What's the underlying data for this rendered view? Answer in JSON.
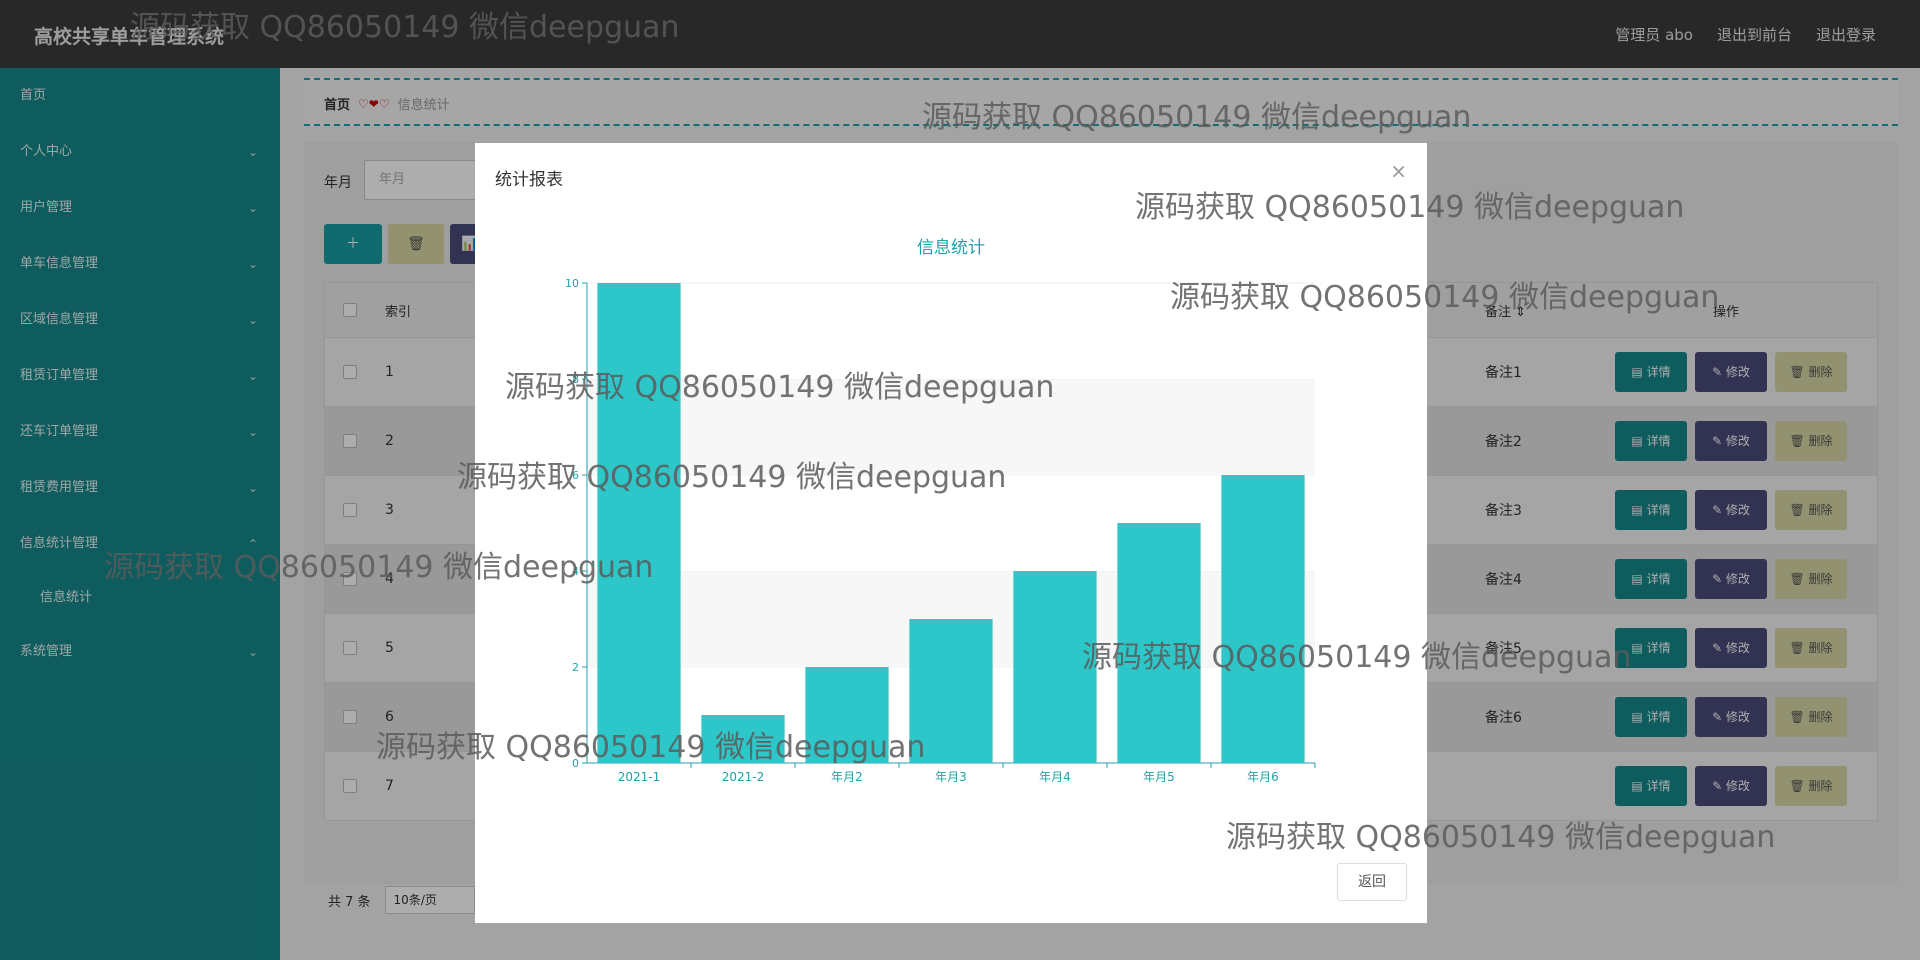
{
  "header": {
    "brand": "高校共享单车管理系统",
    "admin": "管理员 abo",
    "to_front": "退出到前台",
    "logout": "退出登录"
  },
  "sidebar": {
    "items": [
      {
        "label": "首页",
        "chevron": false
      },
      {
        "label": "个人中心",
        "chevron": true
      },
      {
        "label": "用户管理",
        "chevron": true
      },
      {
        "label": "单车信息管理",
        "chevron": true
      },
      {
        "label": "区域信息管理",
        "chevron": true
      },
      {
        "label": "租赁订单管理",
        "chevron": true
      },
      {
        "label": "还车订单管理",
        "chevron": true
      },
      {
        "label": "租赁费用管理",
        "chevron": true
      },
      {
        "label": "信息统计管理",
        "chevron": true
      },
      {
        "label": "系统管理",
        "chevron": true
      }
    ],
    "sub_item": "信息统计"
  },
  "breadcrumb": {
    "home": "首页",
    "separator": "♡❤♡",
    "current": "信息统计"
  },
  "filter": {
    "label": "年月",
    "placeholder": "年月"
  },
  "toolbar": {
    "add": "＋",
    "delete": "🗑",
    "stat": "📊"
  },
  "table": {
    "headers": {
      "index": "索引",
      "remark": "备注 ⇕",
      "actions": "操作"
    },
    "rows": [
      {
        "index": "1",
        "remark": "备注1"
      },
      {
        "index": "2",
        "remark": "备注2"
      },
      {
        "index": "3",
        "remark": "备注3"
      },
      {
        "index": "4",
        "remark": "备注4"
      },
      {
        "index": "5",
        "remark": "备注5"
      },
      {
        "index": "6",
        "remark": "备注6"
      },
      {
        "index": "7",
        "remark": ""
      }
    ],
    "actions": {
      "detail": "▤ 详情",
      "edit": "✎ 修改",
      "remove": "🗑 删除"
    }
  },
  "pager": {
    "total": "共 7 条",
    "page_size": "10条/页"
  },
  "modal": {
    "title": "统计报表",
    "close": "×",
    "back": "返回"
  },
  "chart_data": {
    "type": "bar",
    "title": "信息统计",
    "categories": [
      "2021-1",
      "2021-2",
      "年月2",
      "年月3",
      "年月4",
      "年月5",
      "年月6"
    ],
    "values": [
      10,
      1,
      2,
      3,
      4,
      5,
      6
    ],
    "ylim": [
      0,
      10
    ],
    "yticks": [
      0,
      2,
      4,
      6,
      8,
      10
    ],
    "grid": true,
    "bar_color": "#2ec7c9",
    "accent": "#1fa3a8"
  },
  "watermark": "源码获取 QQ86050149 微信deepguan"
}
